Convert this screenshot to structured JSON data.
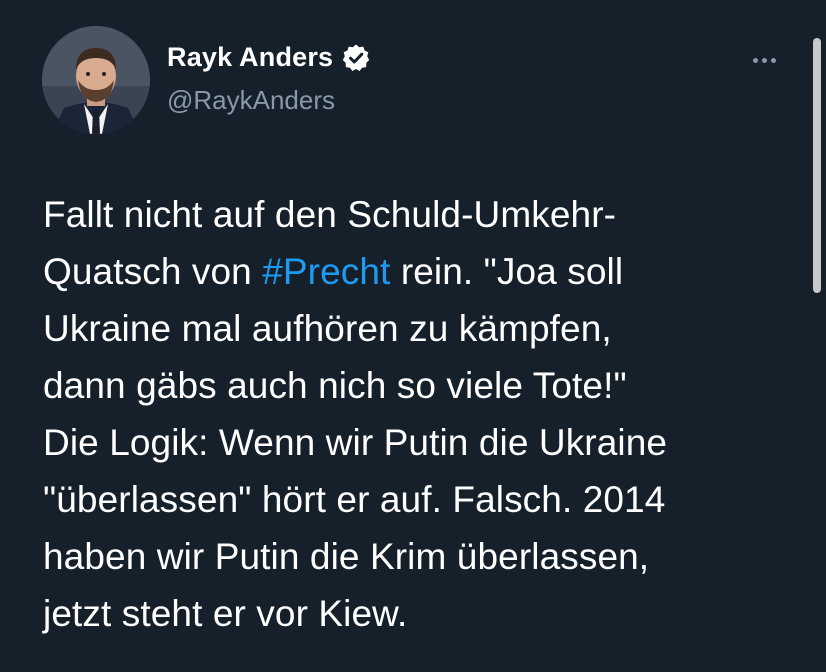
{
  "author": {
    "display_name": "Rayk Anders",
    "handle": "@RaykAnders",
    "verified_icon": "verified-badge-icon"
  },
  "menu": {
    "icon": "more-options-icon"
  },
  "tweet": {
    "lines": [
      {
        "parts": [
          "Fallt nicht auf den Schuld-Umkehr-"
        ]
      },
      {
        "parts": [
          "Quatsch von ",
          "#Precht",
          " rein. \"Joa soll"
        ]
      },
      {
        "parts": [
          "Ukraine mal aufhören zu kämpfen,"
        ]
      },
      {
        "parts": [
          "dann gäbs auch nich so viele Tote!\""
        ]
      },
      {
        "parts": [
          "Die Logik: Wenn wir Putin die Ukraine"
        ]
      },
      {
        "parts": [
          "\"überlassen\" hört er auf. Falsch. 2014"
        ]
      },
      {
        "parts": [
          "haben wir Putin die Krim überlassen,"
        ]
      },
      {
        "parts": [
          "jetzt steht er vor Kiew."
        ]
      }
    ]
  },
  "colors": {
    "background": "#15202b",
    "text": "#ffffff",
    "muted": "#8899a6",
    "link": "#1d9bf0"
  }
}
